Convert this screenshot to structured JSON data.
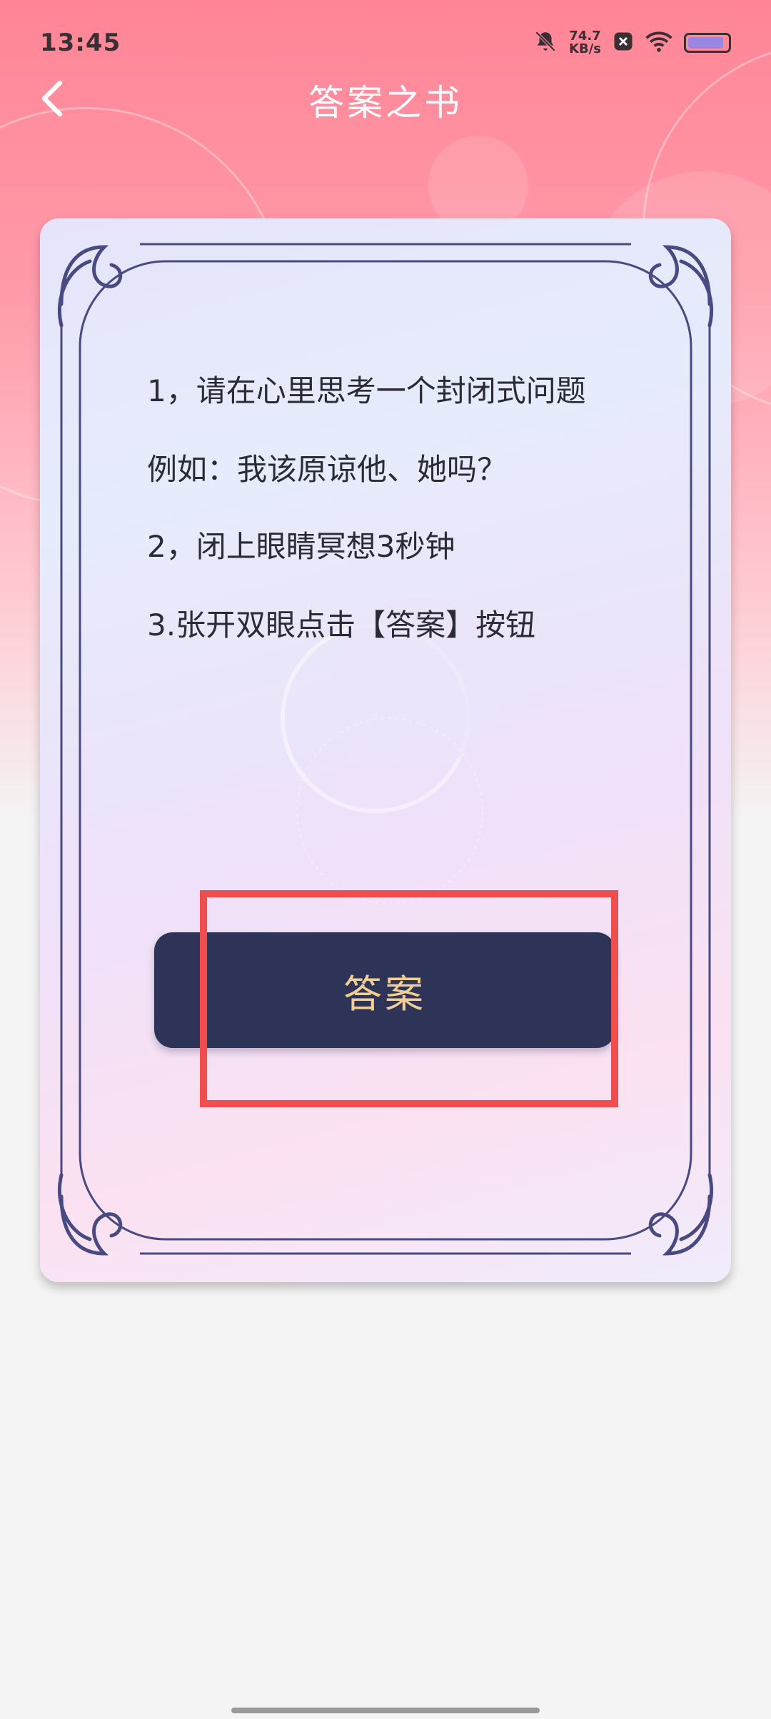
{
  "status_bar": {
    "time": "13:45",
    "net_speed_value": "74.7",
    "net_speed_unit": "KB/s",
    "battery_level": 0.9
  },
  "header": {
    "title": "答案之书",
    "back_icon": "chevron-left-icon"
  },
  "card": {
    "instructions": [
      "1，请在心里思考一个封闭式问题",
      "例如：我该原谅他、她吗？",
      "2，闭上眼睛冥想3秒钟",
      "3.张开双眼点击【答案】按钮"
    ],
    "answer_button_label": "答案"
  },
  "colors": {
    "header_gradient_top": "#ff8596",
    "button_bg": "#2e3457",
    "button_text": "#f3cf93",
    "frame_line": "#4a4a82",
    "highlight": "#f04e4e"
  }
}
